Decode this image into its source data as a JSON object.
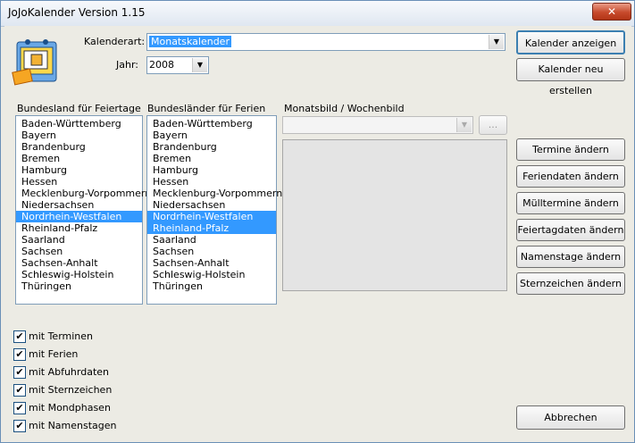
{
  "window": {
    "title": "JoJoKalender Version 1.15",
    "close_glyph": "✕"
  },
  "form": {
    "kalenderart_label": "Kalenderart:",
    "kalenderart_value": "Monatskalender",
    "jahr_label": "Jahr:",
    "jahr_value": "2008"
  },
  "buttons": {
    "anzeigen": "Kalender anzeigen",
    "neu": "Kalender neu erstellen",
    "termine": "Termine ändern",
    "feriendaten": "Feriendaten ändern",
    "muell": "Mülltermine ändern",
    "feiertag": "Feiertagdaten ändern",
    "namenstage": "Namenstage ändern",
    "sternzeichen": "Sternzeichen ändern",
    "abbrechen": "Abbrechen"
  },
  "lists": {
    "feiertage_label": "Bundesland für Feiertage",
    "ferien_label": "Bundesländer für Ferien",
    "bild_label": "Monatsbild / Wochenbild",
    "bild_browse": "...",
    "states": [
      "Baden-Württemberg",
      "Bayern",
      "Brandenburg",
      "Bremen",
      "Hamburg",
      "Hessen",
      "Mecklenburg-Vorpommern",
      "Niedersachsen",
      "Nordrhein-Westfalen",
      "Rheinland-Pfalz",
      "Saarland",
      "Sachsen",
      "Sachsen-Anhalt",
      "Schleswig-Holstein",
      "Thüringen"
    ],
    "feiertage_selected": [
      "Nordrhein-Westfalen"
    ],
    "ferien_selected": [
      "Nordrhein-Westfalen",
      "Rheinland-Pfalz"
    ]
  },
  "checkboxes": [
    {
      "label": "mit Terminen",
      "checked": true
    },
    {
      "label": "mit Ferien",
      "checked": true
    },
    {
      "label": "mit Abfuhrdaten",
      "checked": true
    },
    {
      "label": "mit Sternzeichen",
      "checked": true
    },
    {
      "label": "mit Mondphasen",
      "checked": true
    },
    {
      "label": "mit Namenstagen",
      "checked": true
    }
  ],
  "colors": {
    "selection": "#3399ff",
    "face": "#ecebe4"
  }
}
